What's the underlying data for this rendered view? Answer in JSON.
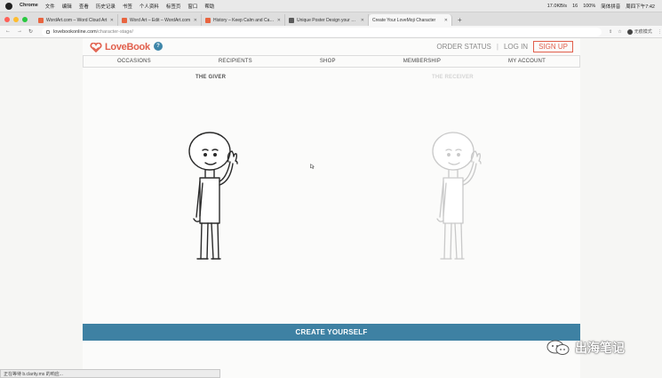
{
  "menubar": {
    "app": "Chrome",
    "items": [
      "文件",
      "编辑",
      "查看",
      "历史记录",
      "书签",
      "个人资料",
      "标签页",
      "窗口",
      "帮助"
    ],
    "status_items": [
      "17.0KB/s",
      "16",
      "100%",
      "简体拼音",
      "周四下午7:42"
    ]
  },
  "tabs": [
    {
      "label": "WordArt.com – Word Cloud Art",
      "color": "#e8643f"
    },
    {
      "label": "Word Art – Edit – WordArt.com",
      "color": "#e8643f"
    },
    {
      "label": "History – Keep Calm and Carry",
      "color": "#e8643f"
    },
    {
      "label": "Unique Poster Design your own",
      "color": "#5a5a5a"
    },
    {
      "label": "Create Your LoveMoji Character",
      "color": "#5a5a5a",
      "active": true
    }
  ],
  "toolbar": {
    "url_host": "lovebookonline.com",
    "url_path": "/character-stage/",
    "profile": "无痕模式"
  },
  "site": {
    "logo": "LoveBook",
    "help": "?",
    "top_nav": {
      "order_status": "ORDER STATUS",
      "login": "LOG IN",
      "signup": "SIGN UP"
    },
    "main_nav": [
      "OCCASIONS",
      "RECIPIENTS",
      "SHOP",
      "MEMBERSHIP",
      "MY ACCOUNT"
    ],
    "giver_label": "THE GIVER",
    "receiver_label": "THE RECEIVER",
    "cta": "CREATE YOURSELF"
  },
  "status_bar": "正在等待 b.clarity.ms 的响应...",
  "watermark": "出海笔记",
  "colors": {
    "brand": "#e15f4c",
    "accent": "#3e81a3"
  }
}
